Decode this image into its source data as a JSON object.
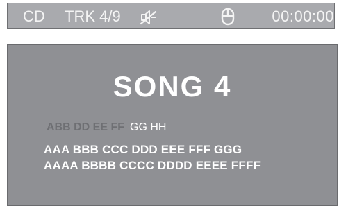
{
  "status": {
    "source": "CD",
    "track": "TRK 4/9",
    "time": "00:00:00",
    "icons": [
      "sound-muted-icon",
      "mouse-icon"
    ]
  },
  "main": {
    "title": "SONG 4",
    "tag_dim": "ABB DD EE FF",
    "tag_bright": "GG HH",
    "line1": "AAA BBB CCC DDD EEE FFF GGG",
    "line2": "AAAA BBBB CCCC DDDD EEEE FFFF"
  },
  "colors": {
    "status_bg": "#a9aaae",
    "panel_bg": "#8f9094",
    "text": "#ffffff",
    "dim_text": "#6e6f73"
  }
}
